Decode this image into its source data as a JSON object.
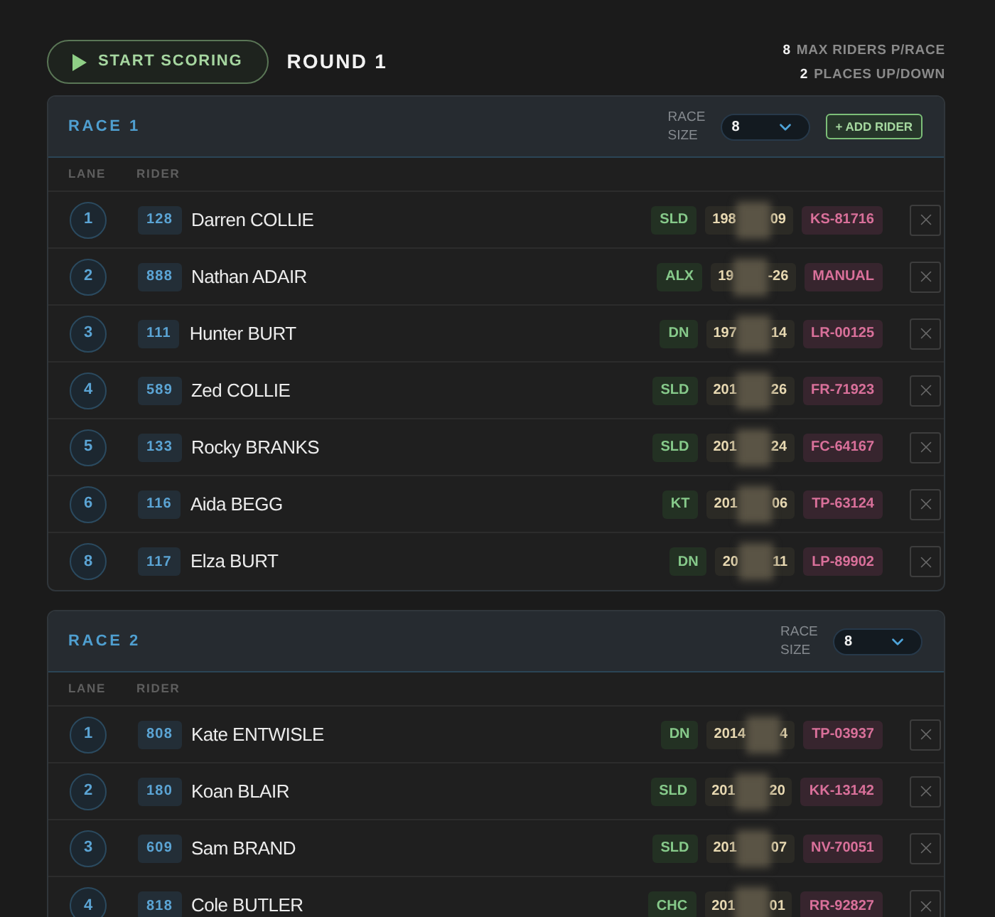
{
  "toolbar": {
    "start_button": "START SCORING",
    "round_title": "ROUND 1",
    "info": [
      {
        "value": "8",
        "label": "MAX RIDERS P/RACE"
      },
      {
        "value": "2",
        "label": "PLACES UP/DOWN"
      }
    ]
  },
  "races": [
    {
      "title": "RACE 1",
      "race_size_label": "RACE SIZE",
      "race_size": "8",
      "add_rider_button": "+ ADD RIDER",
      "columns": [
        "LANE",
        "RIDER"
      ],
      "riders": [
        {
          "lane": "1",
          "bib": "128",
          "name": "Darren COLLIE",
          "class": "SLD",
          "date_start": "198",
          "date_end": "09",
          "license": "KS-81716"
        },
        {
          "lane": "2",
          "bib": "888",
          "name": "Nathan ADAIR",
          "class": "ALX",
          "date_start": "19",
          "date_end": "-26",
          "license": "MANUAL"
        },
        {
          "lane": "3",
          "bib": "111",
          "name": "Hunter BURT",
          "class": "DN",
          "date_start": "197",
          "date_end": "14",
          "license": "LR-00125"
        },
        {
          "lane": "4",
          "bib": "589",
          "name": "Zed COLLIE",
          "class": "SLD",
          "date_start": "201",
          "date_end": "26",
          "license": "FR-71923"
        },
        {
          "lane": "5",
          "bib": "133",
          "name": "Rocky BRANKS",
          "class": "SLD",
          "date_start": "201",
          "date_end": "24",
          "license": "FC-64167"
        },
        {
          "lane": "6",
          "bib": "116",
          "name": "Aida BEGG",
          "class": "KT",
          "date_start": "201",
          "date_end": "06",
          "license": "TP-63124"
        },
        {
          "lane": "8",
          "bib": "117",
          "name": "Elza BURT",
          "class": "DN",
          "date_start": "20",
          "date_end": "11",
          "license": "LP-89902"
        }
      ]
    },
    {
      "title": "RACE 2",
      "race_size_label": "RACE SIZE",
      "race_size": "8",
      "columns": [
        "LANE",
        "RIDER"
      ],
      "riders": [
        {
          "lane": "1",
          "bib": "808",
          "name": "Kate ENTWISLE",
          "class": "DN",
          "date_start": "2014",
          "date_end": "4",
          "license": "TP-03937"
        },
        {
          "lane": "2",
          "bib": "180",
          "name": "Koan BLAIR",
          "class": "SLD",
          "date_start": "201",
          "date_end": "20",
          "license": "KK-13142"
        },
        {
          "lane": "3",
          "bib": "609",
          "name": "Sam BRAND",
          "class": "SLD",
          "date_start": "201",
          "date_end": "07",
          "license": "NV-70051"
        },
        {
          "lane": "4",
          "bib": "818",
          "name": "Cole BUTLER",
          "class": "CHC",
          "date_start": "201",
          "date_end": "01",
          "license": "RR-92827"
        }
      ]
    }
  ]
}
